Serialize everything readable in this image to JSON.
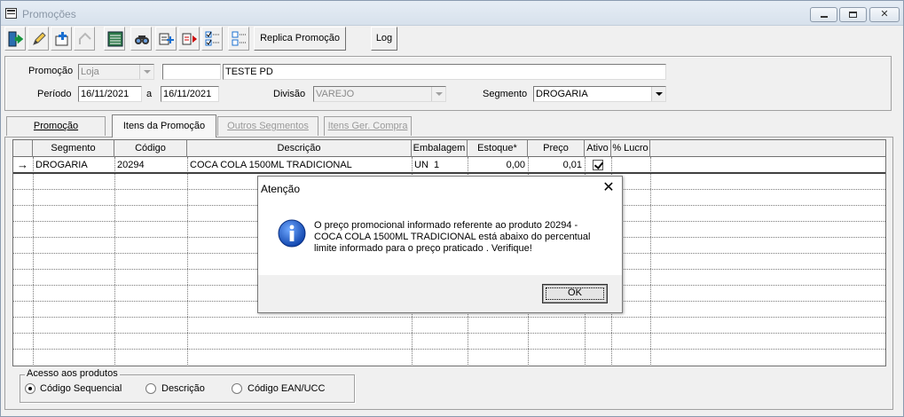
{
  "window": {
    "title": "Promoções",
    "controls": {
      "minimize": "minimize-icon",
      "maximize": "maximize-icon",
      "close": "✕"
    }
  },
  "toolbar": {
    "icons": [
      "exit-icon",
      "edit-icon",
      "add-icon",
      "disabled-icon",
      "list-icon",
      "search-icon",
      "insert-icon",
      "export-icon",
      "checklist-icon",
      "unchecklist-icon"
    ],
    "replica_label": "Replica Promoção",
    "log_label": "Log"
  },
  "header": {
    "promocao_label": "Promoção",
    "promocao_type": "Loja",
    "promocao_code": "",
    "promocao_name": "TESTE PD",
    "periodo_label": "Período",
    "periodo_from": "16/11/2021",
    "periodo_sep": "a",
    "periodo_to": "16/11/2021",
    "divisao_label": "Divisão",
    "divisao_value": "VAREJO",
    "segmento_label": "Segmento",
    "segmento_value": "DROGARIA"
  },
  "tabs": [
    {
      "label": "Promoção",
      "state": "normal"
    },
    {
      "label": "Itens da Promoção",
      "state": "active"
    },
    {
      "label": "Outros Segmentos",
      "state": "disabled"
    },
    {
      "label": "Itens Ger. Compra",
      "state": "disabled"
    }
  ],
  "grid": {
    "columns": [
      "Segmento",
      "Código",
      "Descrição",
      "Embalagem",
      "Estoque*",
      "Preço",
      "Ativo",
      "% Lucro"
    ],
    "rows": [
      {
        "segmento": "DROGARIA",
        "codigo": "20294",
        "descricao": "COCA COLA 1500ML TRADICIONAL",
        "embalagem": "UN  1",
        "estoque": "0,00",
        "preco": "0,01",
        "ativo": true,
        "lucro": ""
      }
    ],
    "row_indicator": "→"
  },
  "acesso": {
    "legend": "Acesso aos produtos",
    "options": [
      "Código Sequencial",
      "Descrição",
      "Código EAN/UCC"
    ],
    "selected": "Código Sequencial"
  },
  "dialog": {
    "title": "Atenção",
    "close": "✕",
    "message_lines": [
      "O preço promocional informado referente ao produto 20294 -",
      "COCA COLA 1500ML TRADICIONAL está abaixo do percentual",
      "limite informado para o preço praticado . Verifique!"
    ],
    "ok_label": "OK",
    "icon": "info-icon"
  },
  "colors": {
    "window_bg": "#f0f0f0",
    "titlebar": "#dce5ee",
    "info_blue": "#1f5fbf"
  }
}
